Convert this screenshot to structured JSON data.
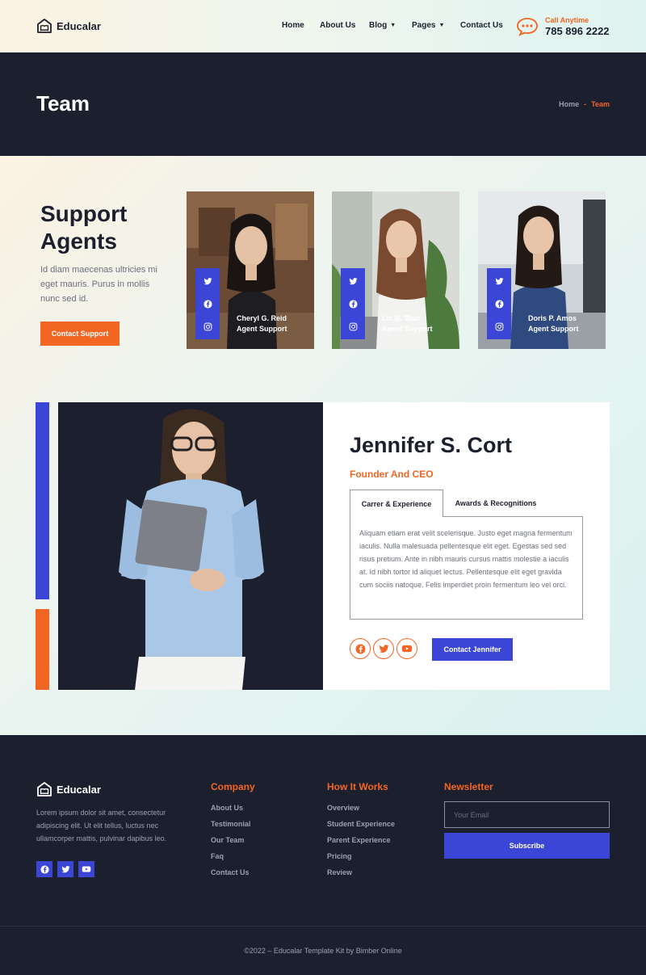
{
  "header": {
    "logo_text": "Educalar",
    "nav": [
      "Home",
      "About Us",
      "Blog",
      "Pages",
      "Contact Us"
    ],
    "call_label": "Call Anytime",
    "call_number": "785 896 2222"
  },
  "banner": {
    "title": "Team",
    "breadcrumb_home": "Home",
    "breadcrumb_sep": "-",
    "breadcrumb_current": "Team"
  },
  "support": {
    "title": "Support Agents",
    "text": "Id diam maecenas ultricies mi eget mauris. Purus in mollis nunc sed id.",
    "button": "Contact Support"
  },
  "agents": [
    {
      "name": "Cheryl G. Reid",
      "role": "Agent Support"
    },
    {
      "name": "Liz M. Stair",
      "role": "Agent Support"
    },
    {
      "name": "Doris P. Amos",
      "role": "Agent Support"
    }
  ],
  "featured": {
    "name": "Jennifer S. Cort",
    "role": "Founder And CEO",
    "tabs": [
      "Carrer & Experience",
      "Awards & Recognitions"
    ],
    "tab_text": "Aliquam etiam erat velit scelerisque. Justo eget magna fermentum iaculis. Nulla malesuada pellentesque elit eget. Egestas sed sed risus pretium. Ante in nibh mauris cursus mattis molestie a iaculis at. Id nibh tortor id aliquet lectus. Pellentesque elit eget gravida cum sociis natoque. Felis imperdiet proin fermentum leo vel orci.",
    "button": "Contact Jennifer"
  },
  "footer": {
    "logo_text": "Educalar",
    "about": "Lorem ipsum dolor sit amet, consectetur adipiscing elit. Ut elit tellus, luctus nec ullamcorper mattis, pulvinar dapibus leo.",
    "company": {
      "title": "Company",
      "links": [
        "About Us",
        "Testimonial",
        "Our Team",
        "Faq",
        "Contact Us"
      ]
    },
    "how": {
      "title": "How It Works",
      "links": [
        "Overview",
        "Student Experience",
        "Parent Experience",
        "Pricing",
        "Review"
      ]
    },
    "newsletter": {
      "title": "Newsletter",
      "placeholder": "Your Email",
      "button": "Subscribe"
    },
    "copyright": "©2022 – Educalar Template Kit by Bimber Online"
  },
  "colors": {
    "accent": "#f26522",
    "primary": "#3b46d6",
    "dark": "#1c1f2e"
  }
}
